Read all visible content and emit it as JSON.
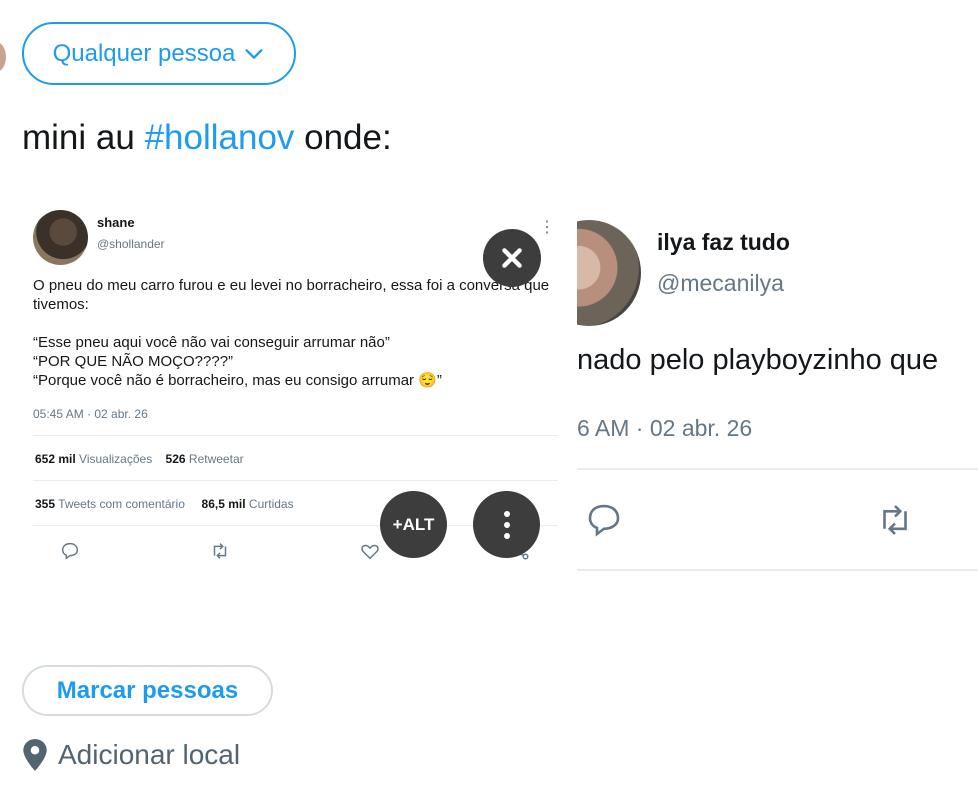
{
  "compose": {
    "audience_label": "Qualquer pessoa",
    "text_before": "mini au ",
    "hashtag": "#hollanov",
    "text_after": " onde:"
  },
  "media_1": {
    "name": "shane",
    "handle": "@shollander",
    "body_lines": [
      "O pneu do meu carro furou e eu levei no borracheiro, essa foi a conversa que tivemos:",
      "“Esse pneu aqui você não vai conseguir arrumar não”",
      "“POR QUE NÃO MOÇO????”",
      "“Porque você não é borracheiro, mas eu consigo arrumar 😌”"
    ],
    "timestamp": "05:45 AM · 02 abr. 26",
    "views_count": "652 mil",
    "views_label": "Visualizações",
    "retweets_count": "526",
    "retweets_label": "Retweetar",
    "replies_count": "355",
    "replies_label": "Tweets com comentário",
    "likes_count": "86,5 mil",
    "likes_label": "Curtidas"
  },
  "media_controls": {
    "alt_label": "+ALT"
  },
  "media_2": {
    "name": "ilya faz tudo",
    "handle": "@mecanilya",
    "text": "nado pelo playboyzinho que",
    "timestamp": "6 AM · 02 abr. 26"
  },
  "footer": {
    "tag_label": "Marcar pessoas",
    "location_label": "Adicionar local"
  },
  "colors": {
    "accent": "#1d9bf0",
    "overlay_button": "#3d3d3d"
  }
}
